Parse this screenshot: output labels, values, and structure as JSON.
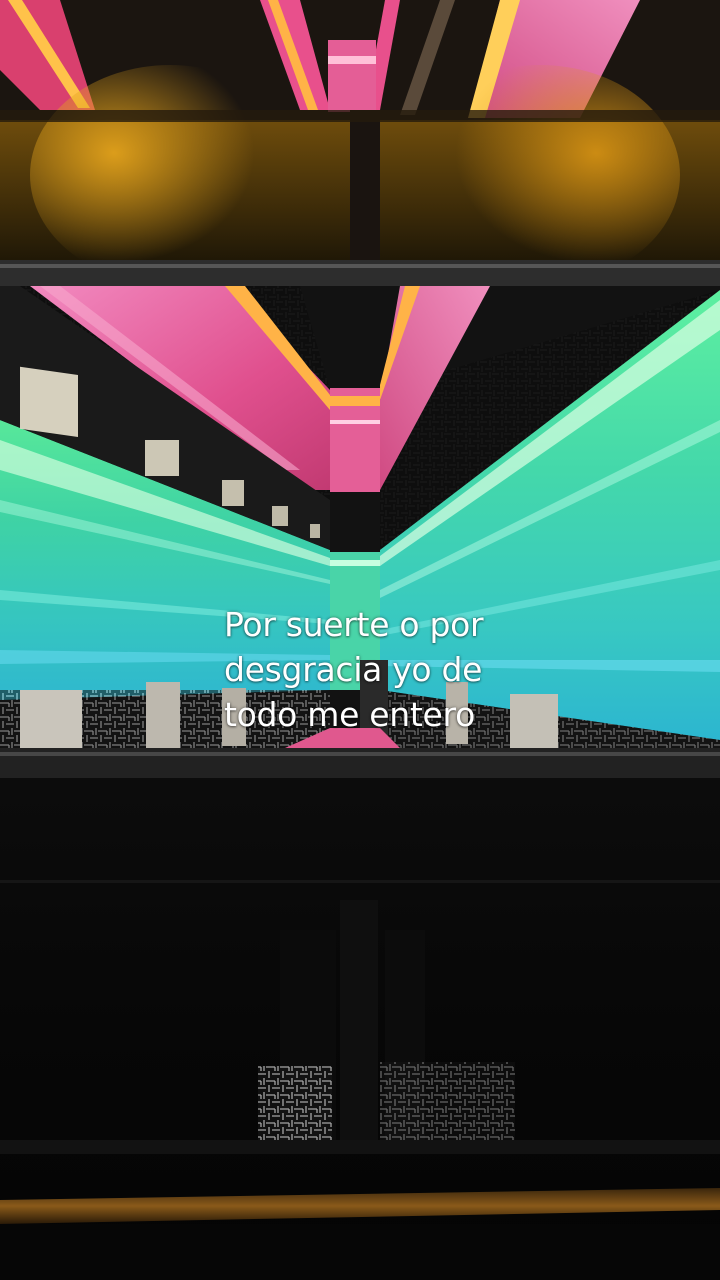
{
  "video": {
    "caption_lines": [
      "Por suerte o por",
      "desgracia yo de",
      "todo me entero"
    ]
  },
  "scene": {
    "subject": "mirrored elevator ceiling reflecting neon-lit corridor",
    "colors": {
      "neon_pink": "#e8609c",
      "neon_orange": "#ffb347",
      "neon_green": "#4fe0a0",
      "neon_teal": "#3fc9c9",
      "amber_glow": "#d79a1e",
      "dark_wall": "#0b0b0b"
    }
  }
}
